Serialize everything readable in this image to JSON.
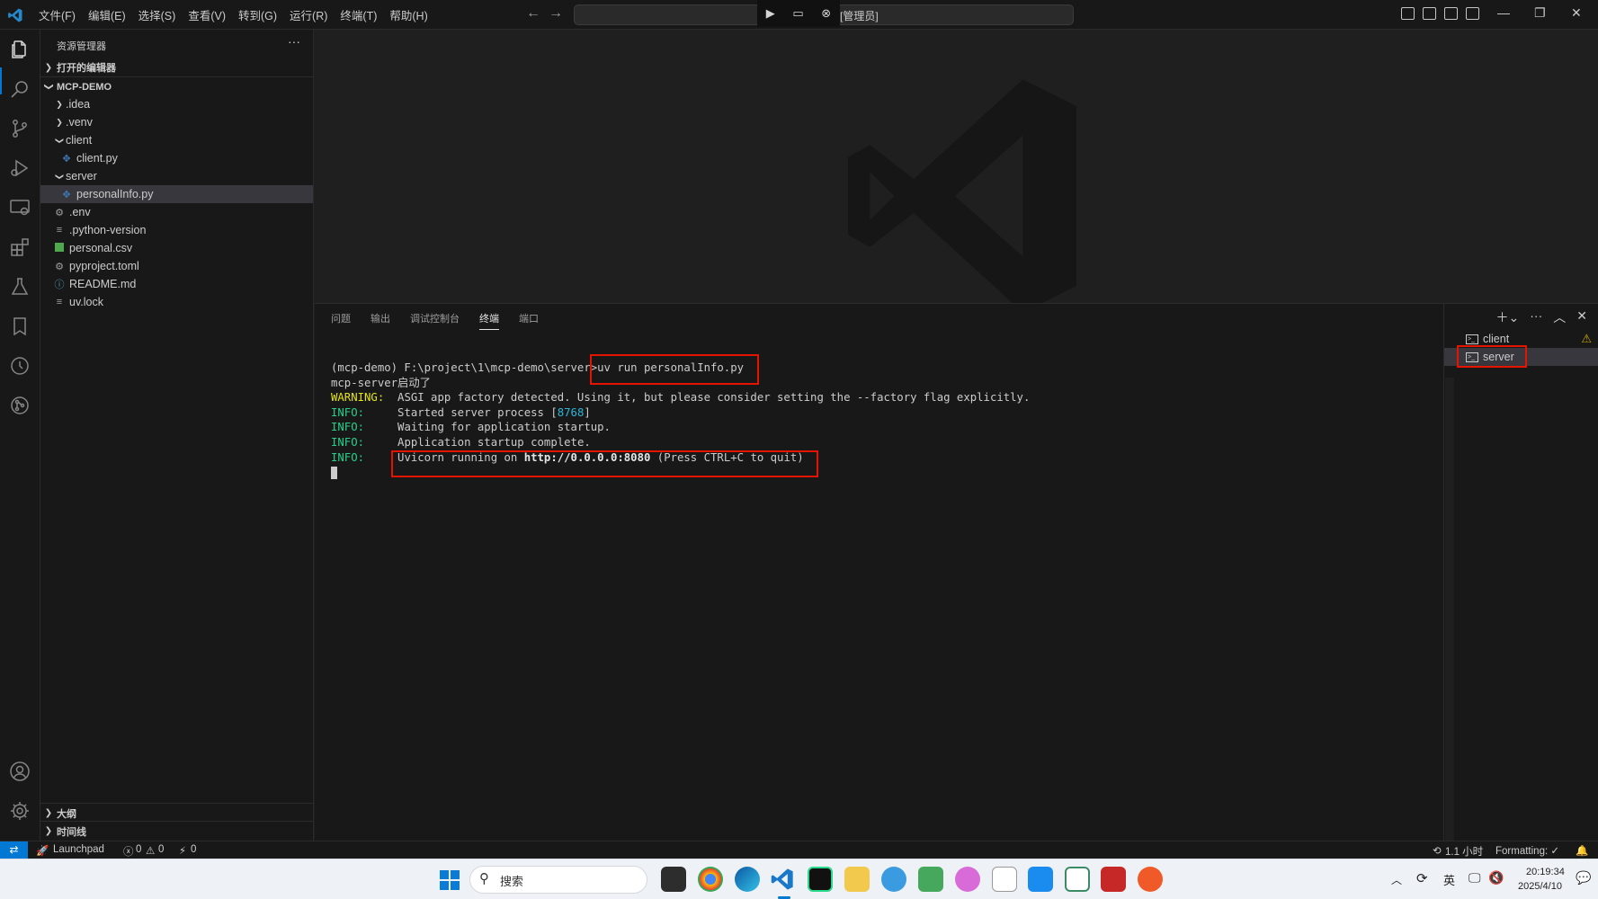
{
  "titlebar": {
    "menu": [
      "文件(F)",
      "编辑(E)",
      "选择(S)",
      "查看(V)",
      "转到(G)",
      "运行(R)",
      "终端(T)",
      "帮助(H)"
    ],
    "command_center_text": "[管理员]"
  },
  "sidebar": {
    "title": "资源管理器",
    "more": "···",
    "open_editors_label": "打开的编辑器",
    "project_label": "MCP-DEMO",
    "tree": [
      {
        "label": ".idea",
        "depth": 1,
        "kind": "folder-collapsed"
      },
      {
        "label": ".venv",
        "depth": 1,
        "kind": "folder-collapsed"
      },
      {
        "label": "client",
        "depth": 1,
        "kind": "folder-expanded"
      },
      {
        "label": "client.py",
        "depth": 2,
        "kind": "python"
      },
      {
        "label": "server",
        "depth": 1,
        "kind": "folder-expanded"
      },
      {
        "label": "personalInfo.py",
        "depth": 2,
        "kind": "python",
        "selected": true
      },
      {
        "label": ".env",
        "depth": 1,
        "kind": "gear"
      },
      {
        "label": ".python-version",
        "depth": 1,
        "kind": "lines"
      },
      {
        "label": "personal.csv",
        "depth": 1,
        "kind": "csv"
      },
      {
        "label": "pyproject.toml",
        "depth": 1,
        "kind": "gear"
      },
      {
        "label": "README.md",
        "depth": 1,
        "kind": "info"
      },
      {
        "label": "uv.lock",
        "depth": 1,
        "kind": "lines"
      }
    ],
    "outline_label": "大纲",
    "timeline_label": "时间线"
  },
  "panel": {
    "tabs": [
      "问题",
      "输出",
      "调试控制台",
      "终端",
      "端口"
    ],
    "active_tab": "终端",
    "terminal": {
      "prompt": "(mcp-demo) F:\\project\\1\\mcp-demo\\server>",
      "command": "uv run personalInfo.py",
      "line2": "mcp-server启动了",
      "warning_label": "WARNING:",
      "warning_text": "  ASGI app factory detected. Using it, but please consider setting the --factory flag explicitly.",
      "info_label": "INFO:",
      "info1_a": "     Started server process [",
      "info1_pid": "8768",
      "info1_b": "]",
      "info2": "     Waiting for application startup.",
      "info3": "     Application startup complete.",
      "info4_a": "     Uvicorn running on ",
      "info4_url": "http://0.0.0.0:8080",
      "info4_b": " (Press CTRL+C to quit)"
    },
    "terminals": [
      {
        "label": "client",
        "warning": true
      },
      {
        "label": "server",
        "selected": true
      }
    ]
  },
  "statusbar": {
    "launchpad": "Launchpad",
    "errors": "0",
    "warnings": "0",
    "ports": "0",
    "time_spent": "1.1 小时",
    "formatting": "Formatting: ✓"
  },
  "taskbar": {
    "search_placeholder": "搜索",
    "time": "20:19:34",
    "date": "2025/4/10",
    "ime": "英"
  },
  "colors": {
    "accent": "#0078d4",
    "highlight_box": "#e51400",
    "info_green": "#23d18b",
    "warning_yellow": "#e5e510"
  }
}
